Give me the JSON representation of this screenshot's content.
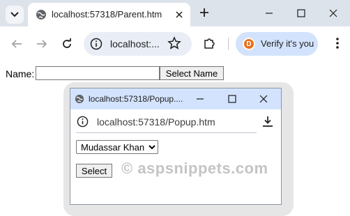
{
  "browser": {
    "tab": {
      "title": "localhost:57318/Parent.htm"
    },
    "omnibox": {
      "url": "localhost:..."
    },
    "profile": {
      "avatar_letter": "D",
      "label": "Verify it's you",
      "accent": "#e8711c"
    },
    "icons": {
      "tab_search": "chevron-down-icon",
      "favicon": "globe-icon",
      "tab_close": "close-icon",
      "new_tab": "plus-icon",
      "minimize": "minimize-icon",
      "maximize": "maximize-icon",
      "close": "close-icon",
      "back": "back-arrow-icon",
      "forward": "forward-arrow-icon",
      "reload": "reload-icon",
      "info": "info-icon",
      "bookmark": "star-icon",
      "extensions": "puzzle-icon",
      "menu": "kebab-menu-icon"
    }
  },
  "page": {
    "name_label": "Name:",
    "name_value": "",
    "select_button": "Select Name"
  },
  "popup": {
    "title": "localhost:57318/Popup....",
    "url": "localhost:57318/Popup.htm",
    "selected_name": "Mudassar Khan",
    "select_button": "Select"
  },
  "watermark": "© aspsnippets.com"
}
